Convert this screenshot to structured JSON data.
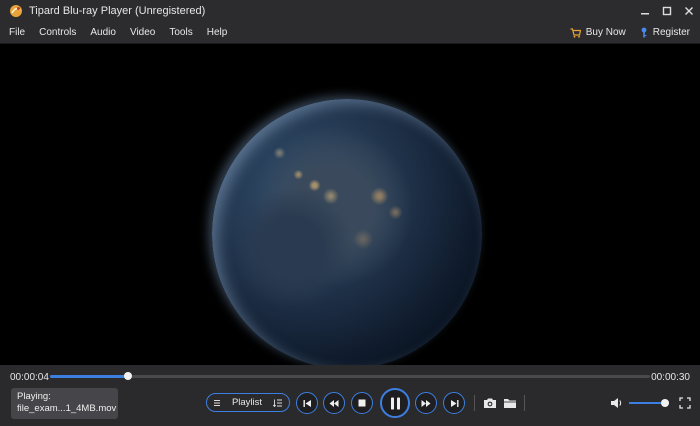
{
  "window": {
    "title": "Tipard Blu-ray Player (Unregistered)",
    "controls": [
      "minimize-icon",
      "maximize-icon",
      "close-icon"
    ]
  },
  "menu": {
    "items": [
      "File",
      "Controls",
      "Audio",
      "Video",
      "Tools",
      "Help"
    ],
    "buy_now": "Buy Now",
    "register": "Register"
  },
  "player": {
    "current_time": "00:00:04",
    "total_time": "00:00:30",
    "progress_fraction": 0.13,
    "now_playing_label": "Playing:",
    "now_playing_file": "file_exam...1_4MB.mov",
    "playlist_label": "Playlist",
    "volume_fraction": 0.9,
    "state": "playing"
  },
  "colors": {
    "accent": "#3d7fe0",
    "bar_bg": "#2c2c2e",
    "controls_bg": "#2a2a2c"
  }
}
